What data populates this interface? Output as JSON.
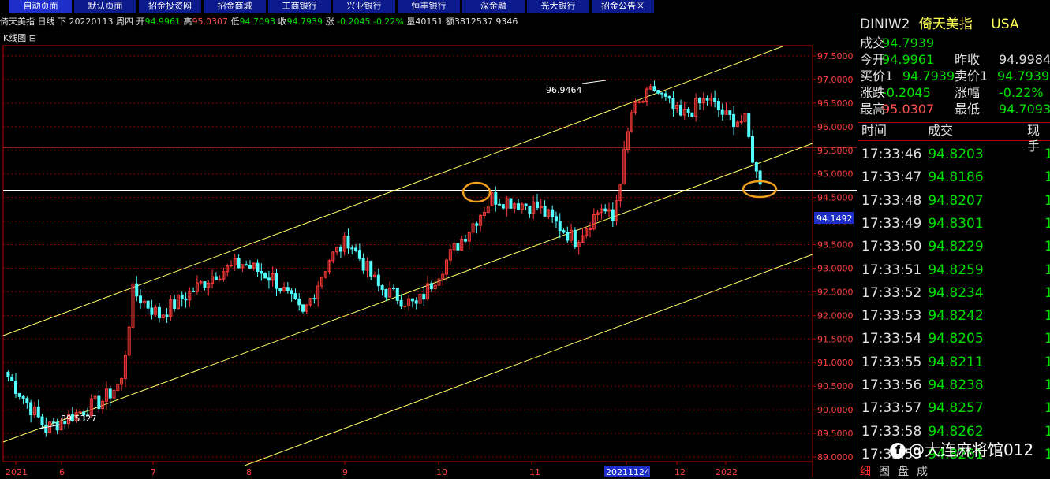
{
  "tabs": [
    "自动页面",
    "默认页面",
    "招金投资网",
    "招金商城",
    "工商银行",
    "兴业银行",
    "恒丰银行",
    "深金融",
    "光大银行",
    "招金公告区"
  ],
  "infoline": {
    "name": "倚天美指 日线 下",
    "date": "20220113 周四",
    "open_label": "开",
    "open": "94.9961",
    "high_label": "高",
    "high": "95.0307",
    "low_label": "低",
    "low": "94.7093",
    "close_label": "收",
    "close": "94.7939",
    "chg_label": "涨",
    "chg": "-0.2045",
    "pct": "-0.22%",
    "vol": "量40151",
    "amt": "额3812537 9346"
  },
  "kline_title": "K线图 ⊟",
  "chart_data": {
    "type": "candlestick",
    "ylim": [
      89.0,
      97.75
    ],
    "yticks": [
      "97.5000",
      "97.0000",
      "96.5000",
      "96.0000",
      "95.5000",
      "95.0000",
      "94.5000",
      "94.0000",
      "93.5000",
      "93.0000",
      "92.5000",
      "92.0000",
      "91.5000",
      "91.0000",
      "90.5000",
      "90.0000",
      "89.5000",
      "89.0000"
    ],
    "xticks": [
      "2021",
      "6",
      "7",
      "8",
      "9",
      "10",
      "11",
      "20211124",
      "12",
      "2022"
    ],
    "price_marker": "94.1492",
    "annotations": [
      "96.9464",
      "89.5327"
    ],
    "colors": {
      "up": "#ff3b3b",
      "down": "#54ffff",
      "grid": "#8b0000",
      "channel": "#ffff66",
      "hline": "#ffffff",
      "circle": "#f0a020"
    }
  },
  "panel": {
    "symbol": "DINIW2",
    "name": "倚天美指",
    "market": "USA",
    "rows": [
      {
        "l1": "成交",
        "v1": "94.7939",
        "c1": "#00e000",
        "l2": "",
        "v2": "",
        "c2": ""
      },
      {
        "l1": "今开",
        "v1": "94.9961",
        "c1": "#00e000",
        "l2": "昨收",
        "v2": "94.9984",
        "c2": "#e0e0e0"
      },
      {
        "l1": "买价1",
        "v1": "94.7939",
        "c1": "#00e000",
        "l2": "卖价1",
        "v2": "94.7939",
        "c2": "#00e000"
      },
      {
        "l1": "涨跌",
        "v1": "-0.2045",
        "c1": "#00e000",
        "l2": "涨幅",
        "v2": "-0.22%",
        "c2": "#00e000"
      },
      {
        "l1": "最高",
        "v1": "95.0307",
        "c1": "#ff5050",
        "l2": "最低",
        "v2": "94.7093",
        "c2": "#00e000"
      }
    ],
    "tick_header": [
      "时间",
      "成交",
      "现手"
    ],
    "ticks": [
      [
        "17:33:46",
        "94.8203"
      ],
      [
        "17:33:47",
        "94.8186"
      ],
      [
        "17:33:48",
        "94.8207"
      ],
      [
        "17:33:49",
        "94.8301"
      ],
      [
        "17:33:50",
        "94.8229"
      ],
      [
        "17:33:51",
        "94.8259"
      ],
      [
        "17:33:52",
        "94.8234"
      ],
      [
        "17:33:53",
        "94.8242"
      ],
      [
        "17:33:54",
        "94.8205"
      ],
      [
        "17:33:55",
        "94.8211"
      ],
      [
        "17:33:56",
        "94.8238"
      ],
      [
        "17:33:57",
        "94.8257"
      ],
      [
        "17:33:58",
        "94.8262"
      ],
      [
        "17:33:59",
        "94.8261"
      ]
    ],
    "bottom_tabs": [
      "细",
      "图",
      "盘",
      "成"
    ]
  },
  "watermark": "@大连麻将馆012"
}
